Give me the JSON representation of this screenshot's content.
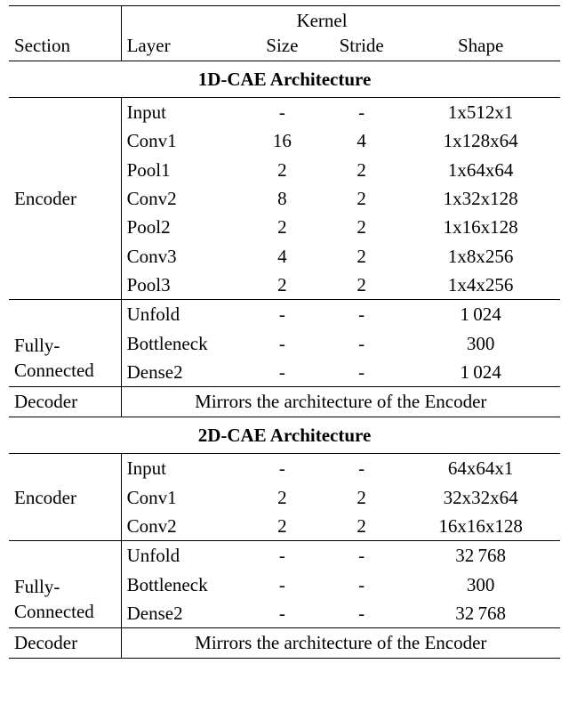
{
  "header": {
    "section": "Section",
    "layer": "Layer",
    "kernel": "Kernel",
    "size": "Size",
    "stride": "Stride",
    "shape": "Shape"
  },
  "labels": {
    "encoder": "Encoder",
    "fc_top": "Fully-",
    "fc_bot": "Connected",
    "decoder": "Decoder",
    "decoder_text": "Mirrors the architecture of the Encoder"
  },
  "arch1": {
    "title": "1D-CAE Architecture",
    "encoder": [
      {
        "layer": "Input",
        "size": "-",
        "stride": "-",
        "shape": "1x512x1"
      },
      {
        "layer": "Conv1",
        "size": "16",
        "stride": "4",
        "shape": "1x128x64"
      },
      {
        "layer": "Pool1",
        "size": "2",
        "stride": "2",
        "shape": "1x64x64"
      },
      {
        "layer": "Conv2",
        "size": "8",
        "stride": "2",
        "shape": "1x32x128"
      },
      {
        "layer": "Pool2",
        "size": "2",
        "stride": "2",
        "shape": "1x16x128"
      },
      {
        "layer": "Conv3",
        "size": "4",
        "stride": "2",
        "shape": "1x8x256"
      },
      {
        "layer": "Pool3",
        "size": "2",
        "stride": "2",
        "shape": "1x4x256"
      }
    ],
    "fc": [
      {
        "layer": "Unfold",
        "size": "-",
        "stride": "-",
        "shape": "1 024"
      },
      {
        "layer": "Bottleneck",
        "size": "-",
        "stride": "-",
        "shape": "300"
      },
      {
        "layer": "Dense2",
        "size": "-",
        "stride": "-",
        "shape": "1 024"
      }
    ]
  },
  "arch2": {
    "title": "2D-CAE Architecture",
    "encoder": [
      {
        "layer": "Input",
        "size": "-",
        "stride": "-",
        "shape": "64x64x1"
      },
      {
        "layer": "Conv1",
        "size": "2",
        "stride": "2",
        "shape": "32x32x64"
      },
      {
        "layer": "Conv2",
        "size": "2",
        "stride": "2",
        "shape": "16x16x128"
      }
    ],
    "fc": [
      {
        "layer": "Unfold",
        "size": "-",
        "stride": "-",
        "shape": "32 768"
      },
      {
        "layer": "Bottleneck",
        "size": "-",
        "stride": "-",
        "shape": "300"
      },
      {
        "layer": "Dense2",
        "size": "-",
        "stride": "-",
        "shape": "32 768"
      }
    ]
  },
  "chart_data": {
    "type": "table",
    "title": "CAE Architectures",
    "tables": [
      {
        "name": "1D-CAE Architecture",
        "columns": [
          "Section",
          "Layer",
          "Kernel Size",
          "Kernel Stride",
          "Shape"
        ],
        "rows": [
          [
            "Encoder",
            "Input",
            "-",
            "-",
            "1x512x1"
          ],
          [
            "Encoder",
            "Conv1",
            "16",
            "4",
            "1x128x64"
          ],
          [
            "Encoder",
            "Pool1",
            "2",
            "2",
            "1x64x64"
          ],
          [
            "Encoder",
            "Conv2",
            "8",
            "2",
            "1x32x128"
          ],
          [
            "Encoder",
            "Pool2",
            "2",
            "2",
            "1x16x128"
          ],
          [
            "Encoder",
            "Conv3",
            "4",
            "2",
            "1x8x256"
          ],
          [
            "Encoder",
            "Pool3",
            "2",
            "2",
            "1x4x256"
          ],
          [
            "Fully-Connected",
            "Unfold",
            "-",
            "-",
            "1024"
          ],
          [
            "Fully-Connected",
            "Bottleneck",
            "-",
            "-",
            "300"
          ],
          [
            "Fully-Connected",
            "Dense2",
            "-",
            "-",
            "1024"
          ],
          [
            "Decoder",
            "Mirrors the architecture of the Encoder",
            "",
            "",
            ""
          ]
        ]
      },
      {
        "name": "2D-CAE Architecture",
        "columns": [
          "Section",
          "Layer",
          "Kernel Size",
          "Kernel Stride",
          "Shape"
        ],
        "rows": [
          [
            "Encoder",
            "Input",
            "-",
            "-",
            "64x64x1"
          ],
          [
            "Encoder",
            "Conv1",
            "2",
            "2",
            "32x32x64"
          ],
          [
            "Encoder",
            "Conv2",
            "2",
            "2",
            "16x16x128"
          ],
          [
            "Fully-Connected",
            "Unfold",
            "-",
            "-",
            "32768"
          ],
          [
            "Fully-Connected",
            "Bottleneck",
            "-",
            "-",
            "300"
          ],
          [
            "Fully-Connected",
            "Dense2",
            "-",
            "-",
            "32768"
          ],
          [
            "Decoder",
            "Mirrors the architecture of the Encoder",
            "",
            "",
            ""
          ]
        ]
      }
    ]
  }
}
